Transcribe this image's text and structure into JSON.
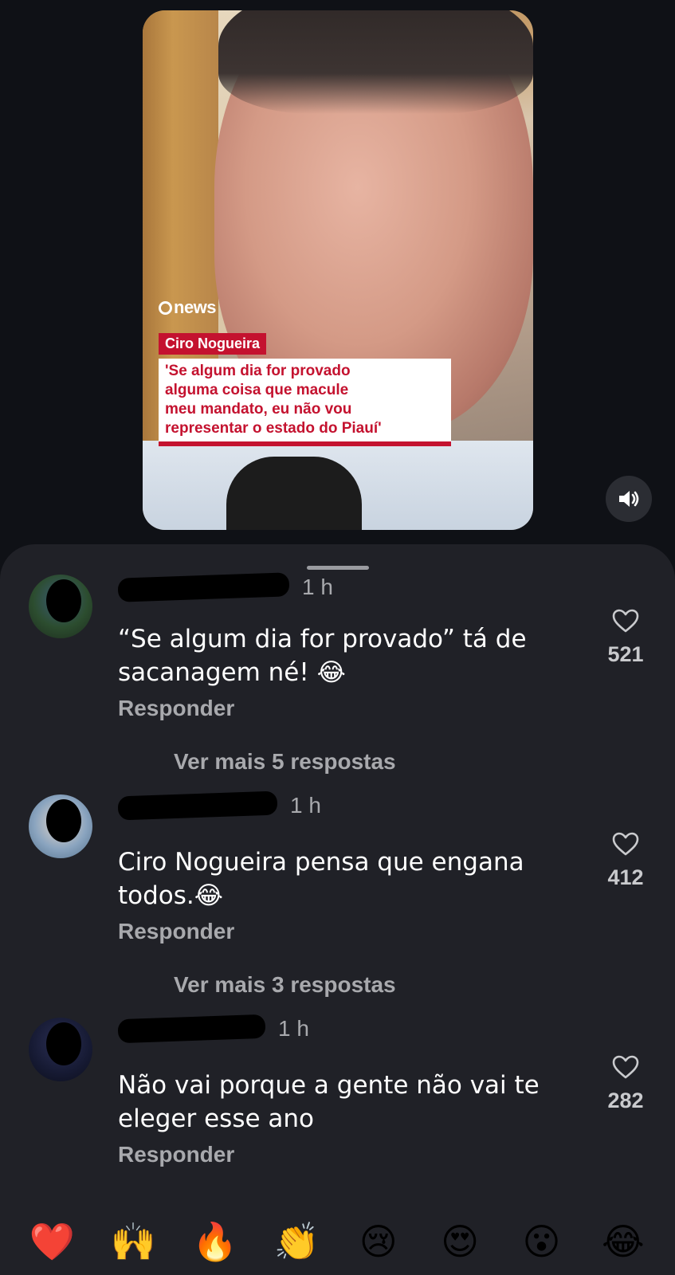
{
  "video": {
    "logo_text": "news",
    "name_tag": "Ciro Nogueira",
    "quote": "'Se algum dia for provado\nalguma coisa que macule\nmeu mandato, eu não vou\nrepresentar o estado do Piauí'",
    "volume_icon": "volume-icon"
  },
  "comments": [
    {
      "time": "1 h",
      "text": "“Se algum dia for provado” tá de sacanagem né! 😂",
      "reply_label": "Responder",
      "likes": "521",
      "more_replies": "Ver mais 5 respostas"
    },
    {
      "time": "1 h",
      "text": "Ciro Nogueira pensa que engana todos.😂",
      "reply_label": "Responder",
      "likes": "412",
      "more_replies": "Ver mais 3 respostas"
    },
    {
      "time": "1 h",
      "text": "Não vai porque a gente não vai te eleger esse ano",
      "reply_label": "Responder",
      "likes": "282"
    }
  ],
  "reactions": [
    "❤️",
    "🙌",
    "🔥",
    "👏",
    "😢",
    "😍",
    "😮",
    "😂"
  ],
  "colors": {
    "background": "#0f1116",
    "sheet": "#202127",
    "accent_red": "#c4122f",
    "secondary_text": "#a8a9ad"
  }
}
